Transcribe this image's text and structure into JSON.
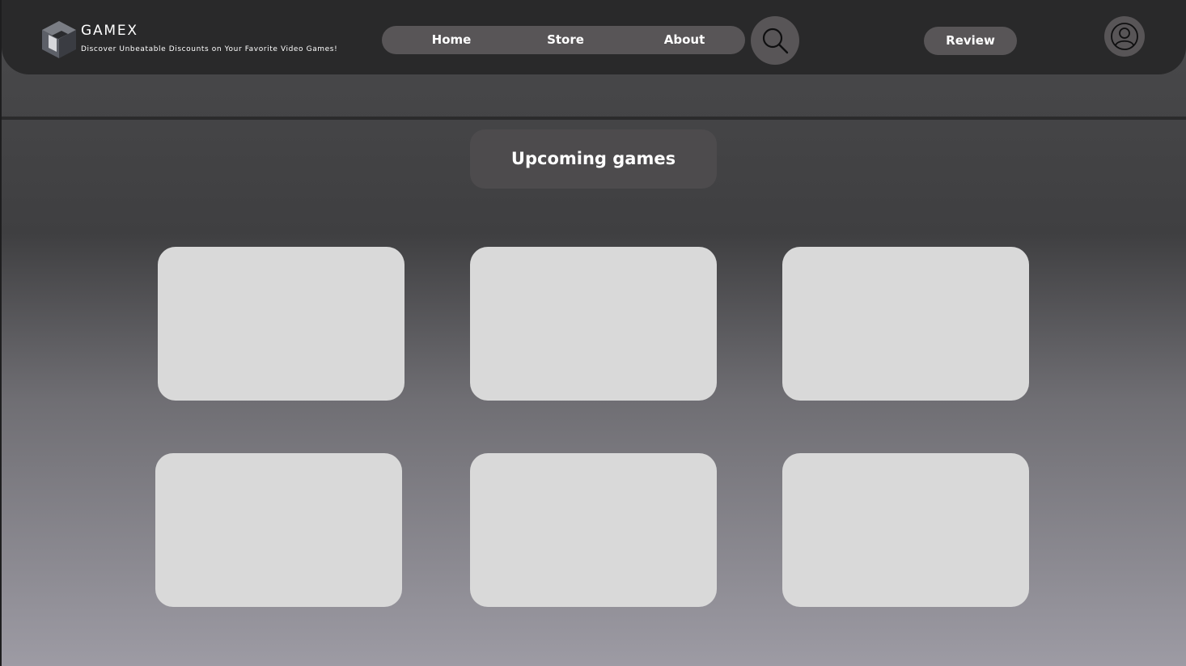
{
  "header": {
    "brand": "GAMEX",
    "tagline": "Discover Unbeatable Discounts on Your Favorite Video Games!",
    "logo_icon": "cube-logo-icon",
    "nav": [
      {
        "label": "Home"
      },
      {
        "label": "Store"
      },
      {
        "label": "About"
      }
    ],
    "search_icon": "search-icon",
    "review_label": "Review",
    "account_icon": "user-avatar-icon"
  },
  "main": {
    "section_title": "Upcoming games",
    "game_cards_count": 6
  },
  "colors": {
    "header_bg": "#29292a",
    "pill_bg": "#585557",
    "card_bg": "#d9d9d9",
    "text": "#ffffff"
  }
}
